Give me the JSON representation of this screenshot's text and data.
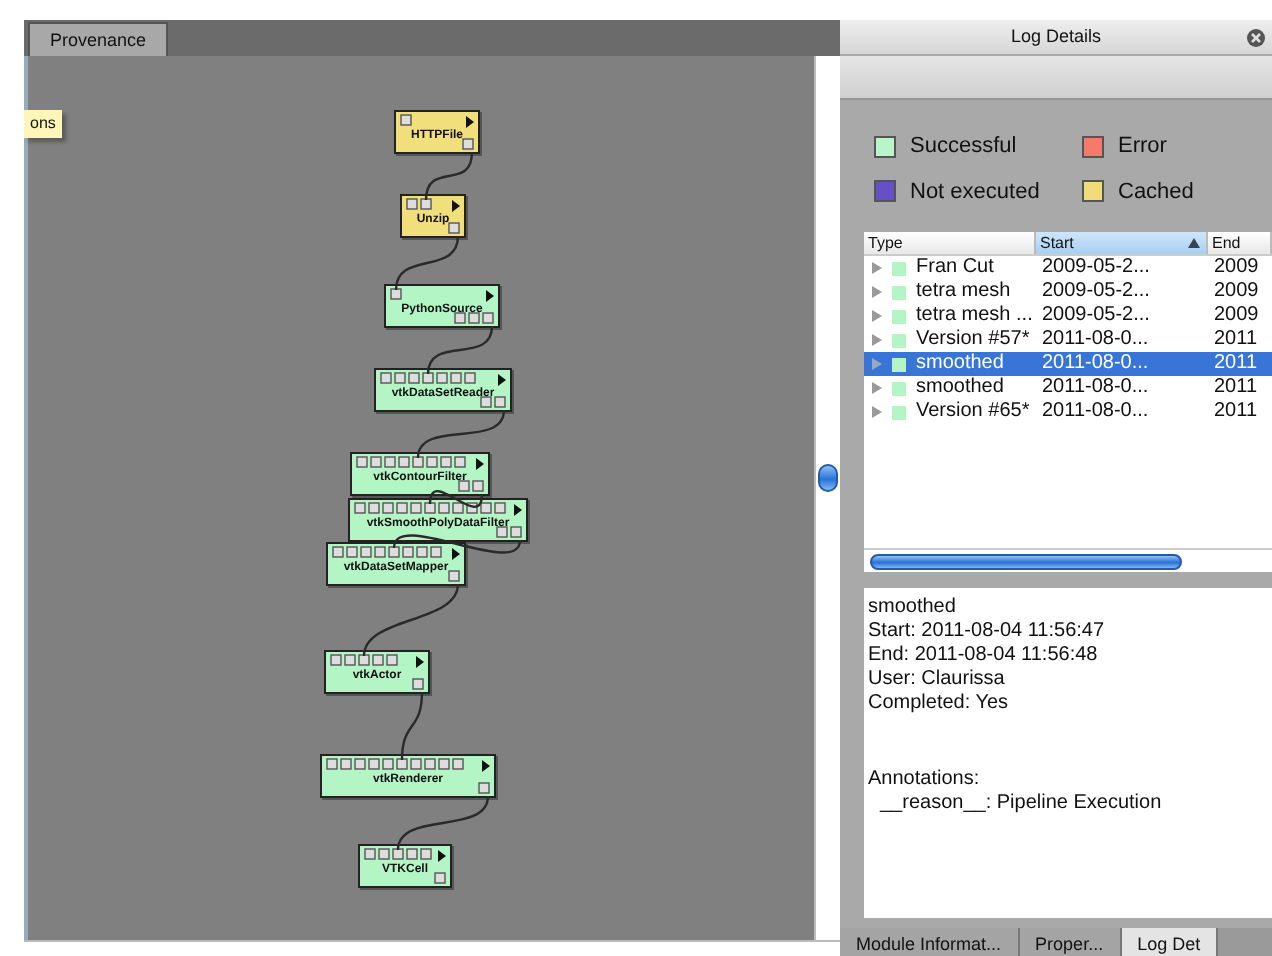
{
  "provenance": {
    "tabs": [
      {
        "label": "Provenance",
        "selected": true
      }
    ],
    "tooltip": "ons",
    "modules": [
      {
        "label": "HTTPFile",
        "color": "#f0df7a"
      },
      {
        "label": "Unzip",
        "color": "#f0df7a"
      },
      {
        "label": "PythonSource",
        "color": "#b4f5c6"
      },
      {
        "label": "vtkDataSetReader",
        "color": "#b4f5c6"
      },
      {
        "label": "vtkContourFilter",
        "color": "#b4f5c6"
      },
      {
        "label": "vtkSmoothPolyDataFilter",
        "color": "#b4f5c6"
      },
      {
        "label": "vtkDataSetMapper",
        "color": "#b4f5c6"
      },
      {
        "label": "vtkActor",
        "color": "#b4f5c6"
      },
      {
        "label": "vtkRenderer",
        "color": "#b4f5c6"
      },
      {
        "label": "VTKCell",
        "color": "#b4f5c6"
      }
    ]
  },
  "log_details": {
    "title": "Log Details",
    "legend": [
      {
        "label": "Successful",
        "color": "#b8f5c8"
      },
      {
        "label": "Error",
        "color": "#f47a6a"
      },
      {
        "label": "Not executed",
        "color": "#6650c8"
      },
      {
        "label": "Cached",
        "color": "#f0dc78"
      }
    ],
    "table": {
      "columns": [
        {
          "label": "Type",
          "sorted": false
        },
        {
          "label": "Start",
          "sorted": true
        },
        {
          "label": "End",
          "sorted": false
        }
      ],
      "rows": [
        {
          "type": "Fran Cut",
          "start": "2009-05-2...",
          "end": "2009",
          "expanded": false,
          "selected": false,
          "color": "#b4f5c6"
        },
        {
          "type": "tetra mesh",
          "start": "2009-05-2...",
          "end": "2009",
          "expanded": false,
          "selected": false,
          "color": "#b4f5c6"
        },
        {
          "type": "tetra mesh ...",
          "start": "2009-05-2...",
          "end": "2009",
          "expanded": false,
          "selected": false,
          "color": "#b4f5c6"
        },
        {
          "type": "Version #57*",
          "start": "2011-08-0...",
          "end": "2011",
          "expanded": false,
          "selected": false,
          "color": "#b4f5c6"
        },
        {
          "type": "smoothed",
          "start": "2011-08-0...",
          "end": "2011",
          "expanded": false,
          "selected": true,
          "color": "#b4f5c6"
        },
        {
          "type": "smoothed",
          "start": "2011-08-0...",
          "end": "2011",
          "expanded": false,
          "selected": false,
          "color": "#b4f5c6"
        },
        {
          "type": "Version #65*",
          "start": "2011-08-0...",
          "end": "2011",
          "expanded": false,
          "selected": false,
          "color": "#b4f5c6"
        }
      ]
    },
    "details": {
      "info": [
        "smoothed",
        "Start: 2011-08-04 11:56:47",
        "End: 2011-08-04 11:56:48",
        "User: Claurissa",
        "Completed: Yes"
      ],
      "annotations_heading": "Annotations:",
      "annotations": [
        "__reason__: Pipeline Execution"
      ]
    }
  },
  "bottom_tabs": [
    {
      "label": "Module Informat...",
      "selected": false
    },
    {
      "label": "Proper...",
      "selected": false
    },
    {
      "label": "Log Det",
      "selected": true
    }
  ]
}
